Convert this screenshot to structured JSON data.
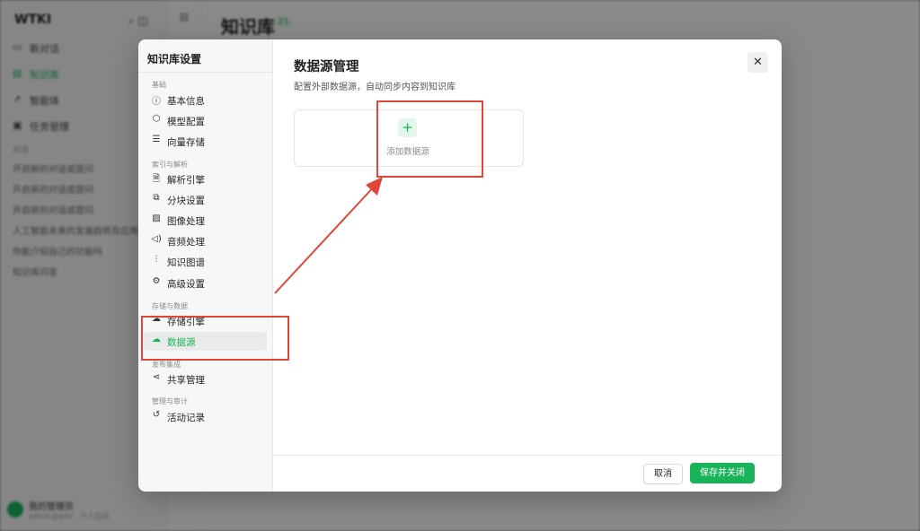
{
  "background": {
    "logo": "WTKI",
    "top_icons": "⌕ ◫",
    "nav": [
      {
        "icon": "▭",
        "label": "新对话"
      },
      {
        "icon": "▤",
        "label": "知识库"
      },
      {
        "icon": "↗",
        "label": "智能体"
      },
      {
        "icon": "▣",
        "label": "任务管理"
      }
    ],
    "section": "对话",
    "docs": [
      "开启新的对话或提问",
      "开启新的对话或提问",
      "开启新的对话或提问",
      "人工智能未来的发展趋势及应用...",
      "你能介绍自己的功能吗",
      "知识库问答"
    ],
    "user_name": "我的管理员",
    "user_mail": "admin@wtki · 个人空间",
    "page_title": "知识库",
    "page_badge": "21"
  },
  "modal": {
    "sidebar_title": "知识库设置",
    "groups": {
      "basic": "基础",
      "index": "索引与解析",
      "storage": "存储与数据",
      "publish": "发布集成",
      "admin": "管理与审计"
    },
    "items": {
      "basic_info": "基本信息",
      "model_config": "模型配置",
      "vector_store": "向量存储",
      "parse_engine": "解析引擎",
      "chunk_settings": "分块设置",
      "image_process": "图像处理",
      "audio_process": "音频处理",
      "knowledge_graph": "知识图谱",
      "advanced": "高级设置",
      "storage_engine": "存储引擎",
      "data_source": "数据源",
      "share_manage": "共享管理",
      "activity_log": "活动记录"
    },
    "main_title": "数据源管理",
    "main_subtitle": "配置外部数据源，自动同步内容到知识库",
    "add_source_label": "添加数据源",
    "cancel_label": "取消",
    "save_label": "保存并关闭"
  },
  "colors": {
    "accent": "#19b35a",
    "annotation": "#e0453a"
  }
}
